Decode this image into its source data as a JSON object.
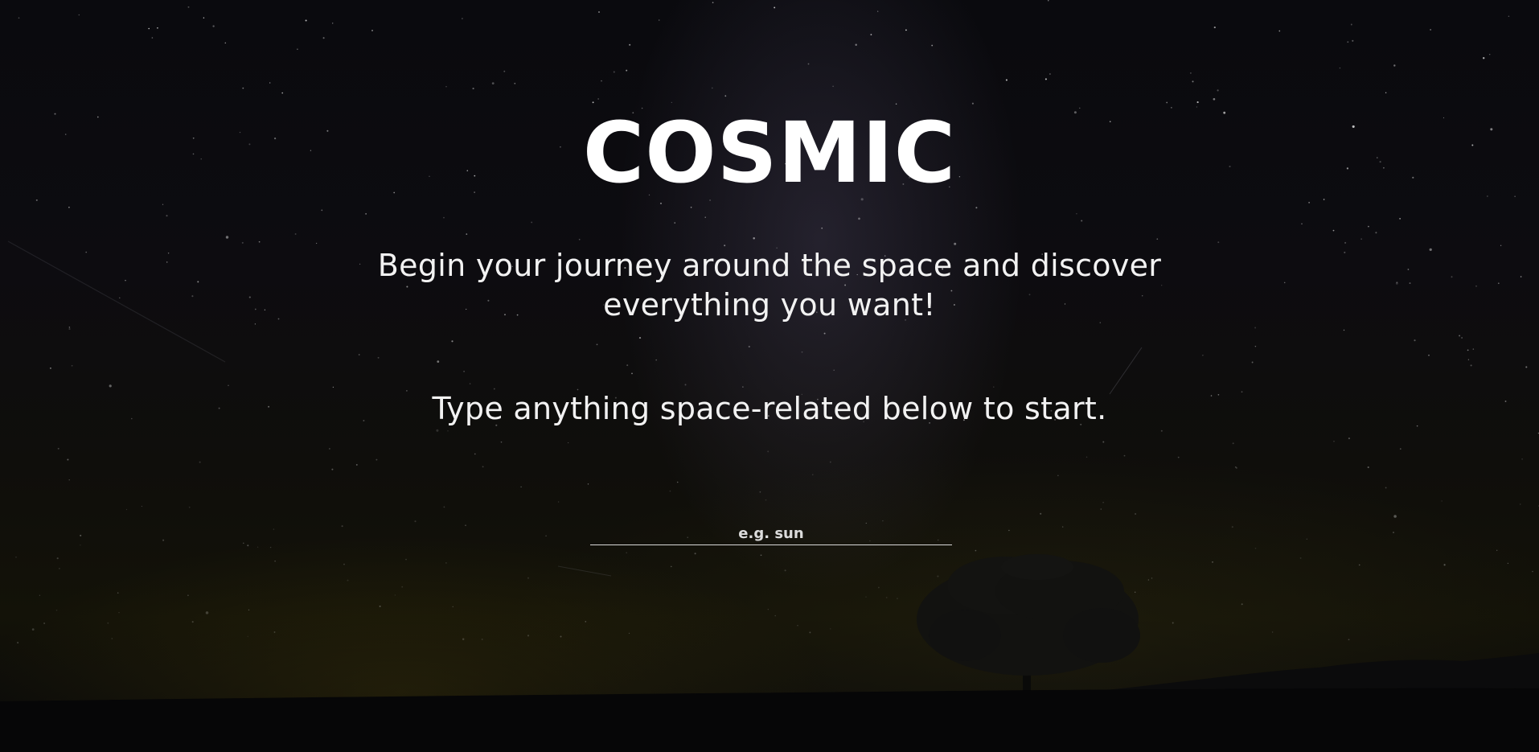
{
  "hero": {
    "title": "COSMIC",
    "tagline": "Begin your journey around the space and discover everything you want!",
    "prompt": "Type anything space-related below to start."
  },
  "search": {
    "placeholder": "e.g. sun",
    "value": ""
  },
  "colors": {
    "background": "#07070a",
    "text": "#ffffff",
    "input_underline": "#d8d8d8"
  }
}
